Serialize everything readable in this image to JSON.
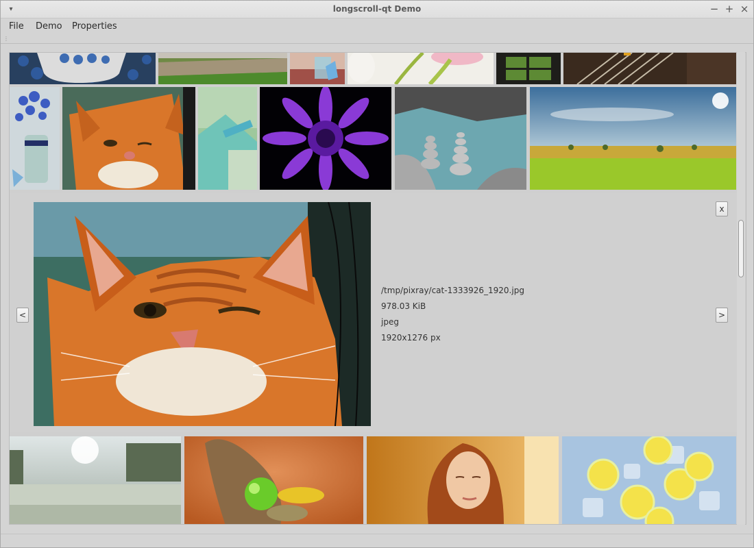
{
  "window": {
    "title": "longscroll-qt Demo",
    "controls": {
      "minimize": "−",
      "maximize": "+",
      "close": "×",
      "menu": "▾"
    }
  },
  "menubar": {
    "items": [
      {
        "label": "File"
      },
      {
        "label": "Demo"
      },
      {
        "label": "Properties"
      }
    ]
  },
  "detail": {
    "close_label": "x",
    "prev_label": "<",
    "next_label": ">",
    "path": "/tmp/pixray/cat-1333926_1920.jpg",
    "size": "978.03 KiB",
    "format": "jpeg",
    "dimensions": "1920x1276 px"
  },
  "thumbnails": {
    "row1": [
      "blueberries",
      "dirt-path",
      "glass-butterfly",
      "tulips",
      "window-garden",
      "piano-keys"
    ],
    "row2": [
      "forget-me-nots",
      "orange-cat",
      "sneakers-car",
      "purple-gerbera",
      "stone-cairns",
      "green-field"
    ],
    "row3": [
      "frosty-meadow",
      "cornucopia",
      "woman-portrait",
      "lemon-slices"
    ]
  },
  "colors": {
    "background": "#cfcfcf",
    "titlebar": "#e3e3e3"
  }
}
